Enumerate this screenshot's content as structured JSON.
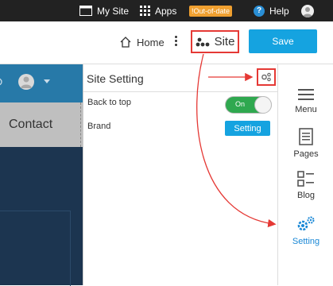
{
  "topbar": {
    "mysite_label": "My Site",
    "apps_label": "Apps",
    "badge_label": "!Out-of-date",
    "help_label": "Help"
  },
  "toolbar": {
    "home_label": "Home",
    "site_label": "Site",
    "save_label": "Save"
  },
  "preview": {
    "contact_label": "Contact"
  },
  "panel": {
    "title": "Site Setting",
    "rows": [
      {
        "label": "Back to top",
        "toggle_label": "On"
      },
      {
        "label": "Brand",
        "button_label": "Setting"
      }
    ]
  },
  "sidebar": {
    "items": [
      {
        "label": "Menu",
        "icon": "menu-icon"
      },
      {
        "label": "Pages",
        "icon": "pages-icon"
      },
      {
        "label": "Blog",
        "icon": "blog-icon"
      },
      {
        "label": "Setting",
        "icon": "gears-icon",
        "active": true
      }
    ]
  },
  "colors": {
    "accent": "#15a3e0",
    "annotation_red": "#e53935",
    "toggle_green": "#2fa84f"
  }
}
